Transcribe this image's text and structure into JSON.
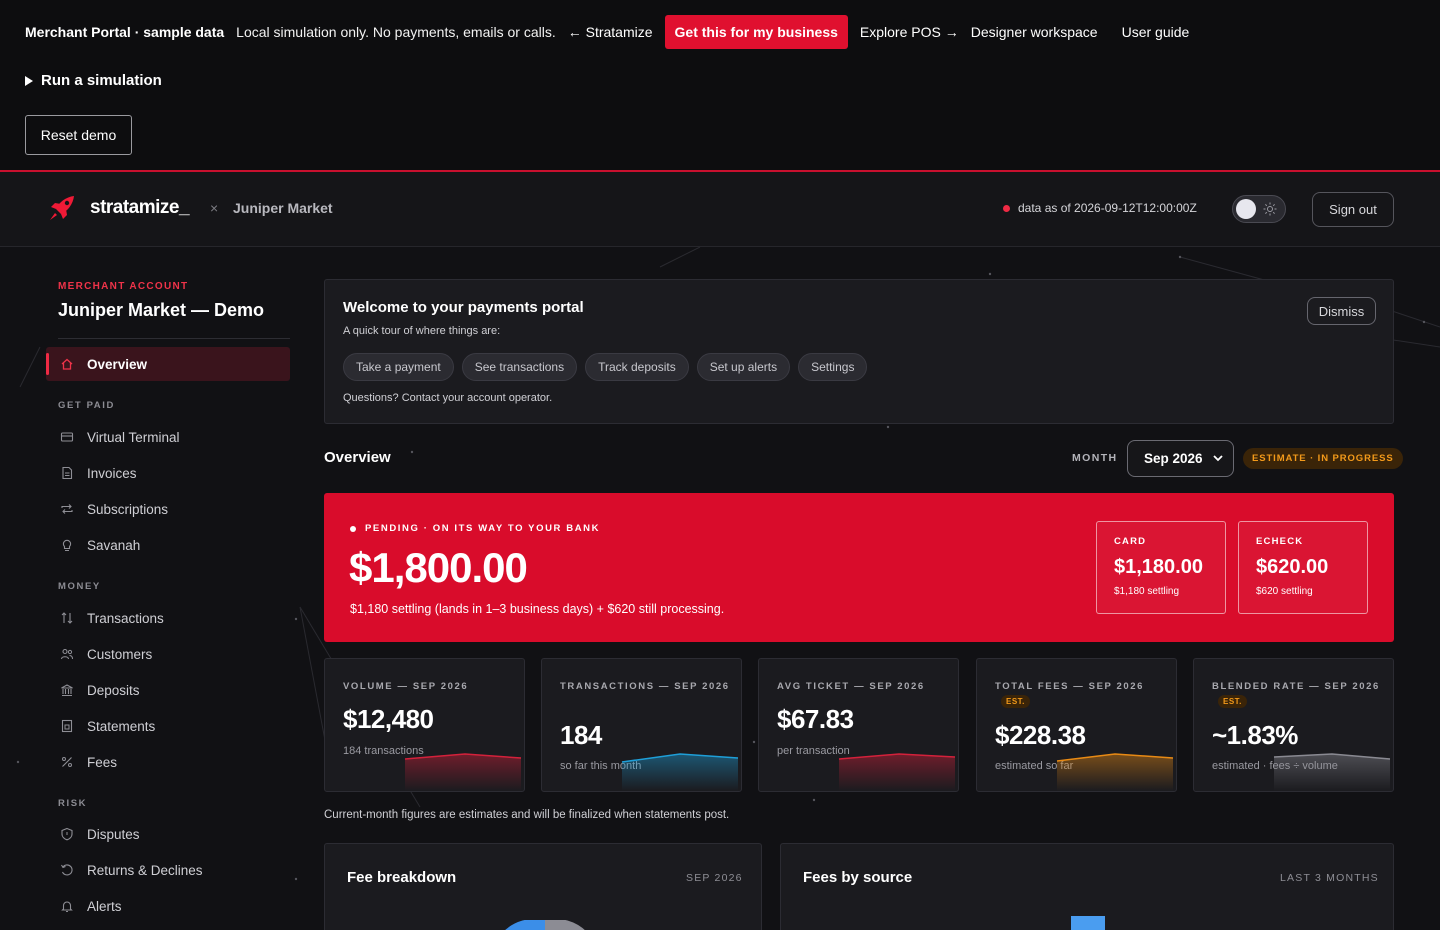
{
  "demo_bar": {
    "brand": "Merchant Portal · sample data",
    "note": "Local simulation only. No payments, emails or calls.",
    "back_link": "← Stratamize",
    "cta": "Get this for my business",
    "explore_pos": "Explore POS →",
    "designer": "Designer workspace",
    "user_guide": "User guide",
    "simulation": "Run a simulation",
    "reset": "Reset demo"
  },
  "header": {
    "logo_word": "stratamize_",
    "separator": "×",
    "merchant": "Juniper Market",
    "data_as_of": "data as of 2026-09-12T12:00:00Z",
    "sign_out": "Sign out"
  },
  "sidebar": {
    "account_label": "MERCHANT ACCOUNT",
    "account_name": "Juniper Market — Demo",
    "overview": "Overview",
    "sections": {
      "get_paid": "GET PAID",
      "money": "MONEY",
      "risk": "RISK"
    },
    "items": [
      {
        "label": "Virtual Terminal",
        "icon": "card-icon"
      },
      {
        "label": "Invoices",
        "icon": "document-icon"
      },
      {
        "label": "Subscriptions",
        "icon": "repeat-icon"
      },
      {
        "label": "Savanah",
        "icon": "bulb-icon"
      },
      {
        "label": "Transactions",
        "icon": "arrows-updown-icon"
      },
      {
        "label": "Customers",
        "icon": "users-icon"
      },
      {
        "label": "Deposits",
        "icon": "bank-icon"
      },
      {
        "label": "Statements",
        "icon": "statement-icon"
      },
      {
        "label": "Fees",
        "icon": "percent-icon"
      },
      {
        "label": "Disputes",
        "icon": "shield-icon"
      },
      {
        "label": "Returns & Declines",
        "icon": "return-icon"
      },
      {
        "label": "Alerts",
        "icon": "bell-icon"
      }
    ]
  },
  "welcome": {
    "title": "Welcome to your payments portal",
    "subtitle": "A quick tour of where things are:",
    "chips": [
      "Take a payment",
      "See transactions",
      "Track deposits",
      "Set up alerts",
      "Settings"
    ],
    "questions": "Questions? Contact your account operator.",
    "dismiss": "Dismiss"
  },
  "overview": {
    "title": "Overview",
    "month_label": "MONTH",
    "month_value": "Sep 2026",
    "estimate_badge": "ESTIMATE · IN PROGRESS"
  },
  "pending": {
    "eyebrow": "PENDING · ON ITS WAY TO YOUR BANK",
    "amount": "$1,800.00",
    "description": "$1,180 settling (lands in 1–3 business days) + $620 still processing.",
    "card": {
      "label": "CARD",
      "value": "$1,180.00",
      "sub": "$1,180 settling"
    },
    "echeck": {
      "label": "ECHECK",
      "value": "$620.00",
      "sub": "$620 settling"
    }
  },
  "stats": [
    {
      "label": "VOLUME — SEP 2026",
      "est": "",
      "value": "$12,480",
      "caption": "184 transactions",
      "color": "#d4213b"
    },
    {
      "label": "TRANSACTIONS — SEP 2026",
      "est": "",
      "value": "184",
      "caption": "so far this month",
      "color": "#1e9fd8"
    },
    {
      "label": "AVG TICKET — SEP 2026",
      "est": "",
      "value": "$67.83",
      "caption": "per transaction",
      "color": "#d4213b"
    },
    {
      "label": "TOTAL FEES — SEP 2026",
      "est": "EST.",
      "value": "$228.38",
      "caption": "estimated so far",
      "color": "#e88a14"
    },
    {
      "label": "BLENDED RATE — SEP 2026",
      "est": "EST.",
      "value": "~1.83%",
      "caption": "estimated · fees ÷ volume",
      "color": "#8a8a92"
    }
  ],
  "footnote": "Current-month figures are estimates and will be finalized when statements post.",
  "fee_breakdown": {
    "title": "Fee breakdown",
    "range": "SEP 2026"
  },
  "fees_by_source": {
    "title": "Fees by source",
    "range": "LAST 3 MONTHS"
  },
  "colors": {
    "accent": "#e0102f",
    "hero": "#d90c2b",
    "estimate": "#f39a1a",
    "background": "#111114"
  }
}
